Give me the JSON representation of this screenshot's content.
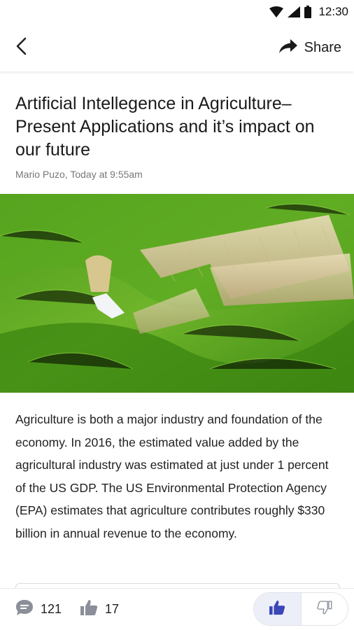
{
  "status": {
    "time": "12:30"
  },
  "app_bar": {
    "share_label": "Share"
  },
  "article": {
    "title": "Artificial Intellegence in Agriculture–Present Applications and it’s impact on our future",
    "byline": "Mario Puzo, Today at 9:55am",
    "body": "Agriculture is both a major industry and foundation of the economy. In 2016, the estimated value added by the agricultural industry was estimated at just under 1 percent of the US GDP. The US Environmental Protection Agency (EPA) estimates that agriculture contributes roughly $330 billion in annual revenue to the economy."
  },
  "bottom_bar": {
    "comments_count": "121",
    "likes_count": "17"
  },
  "colors": {
    "accent": "#3a47b8",
    "text": "#1a1a1a",
    "muted": "#777777"
  }
}
